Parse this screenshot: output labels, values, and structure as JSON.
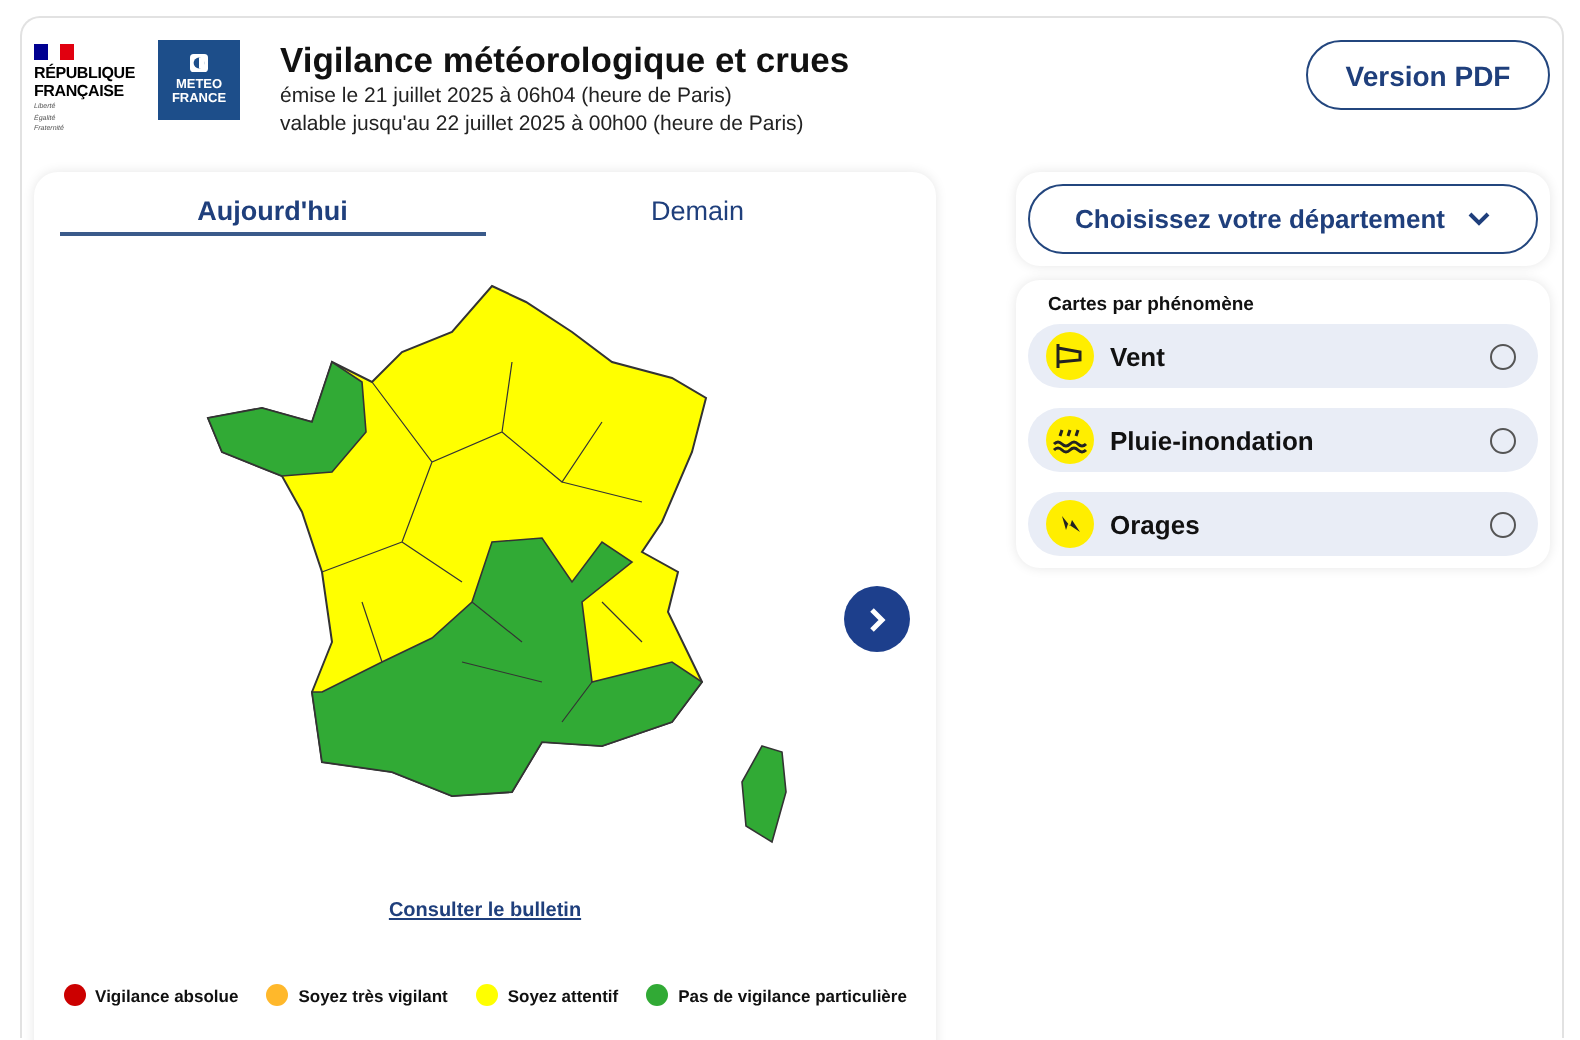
{
  "header": {
    "logo_republique": {
      "name_lines": [
        "RÉPUBLIQUE",
        "FRANÇAISE"
      ],
      "motto_lines": [
        "Liberté",
        "Égalité",
        "Fraternité"
      ]
    },
    "logo_meteo": {
      "lines": [
        "METEO",
        "FRANCE"
      ]
    },
    "title": "Vigilance météorologique et crues",
    "issued": "émise le 21 juillet 2025 à 06h04 (heure de Paris)",
    "valid": "valable jusqu'au 22 juillet 2025 à 00h00 (heure de Paris)",
    "pdf_button": "Version PDF"
  },
  "tabs": [
    {
      "label": "Aujourd'hui",
      "selected": true
    },
    {
      "label": "Demain",
      "selected": false
    }
  ],
  "bulletin_link": "Consulter le bulletin",
  "legend": [
    {
      "label": "Vigilance absolue",
      "color": "#cc0000"
    },
    {
      "label": "Soyez très vigilant",
      "color": "#ffb82b"
    },
    {
      "label": "Soyez attentif",
      "color": "#ffff00"
    },
    {
      "label": "Pas de vigilance particulière",
      "color": "#31aa35"
    }
  ],
  "department_select": {
    "label": "Choisissez votre département"
  },
  "phenomena": {
    "title": "Cartes par phénomène",
    "items": [
      {
        "kind": "wind",
        "label": "Vent",
        "selected": false
      },
      {
        "kind": "rain",
        "label": "Pluie-inondation",
        "selected": false
      },
      {
        "kind": "storm",
        "label": "Orages",
        "selected": false
      }
    ]
  }
}
